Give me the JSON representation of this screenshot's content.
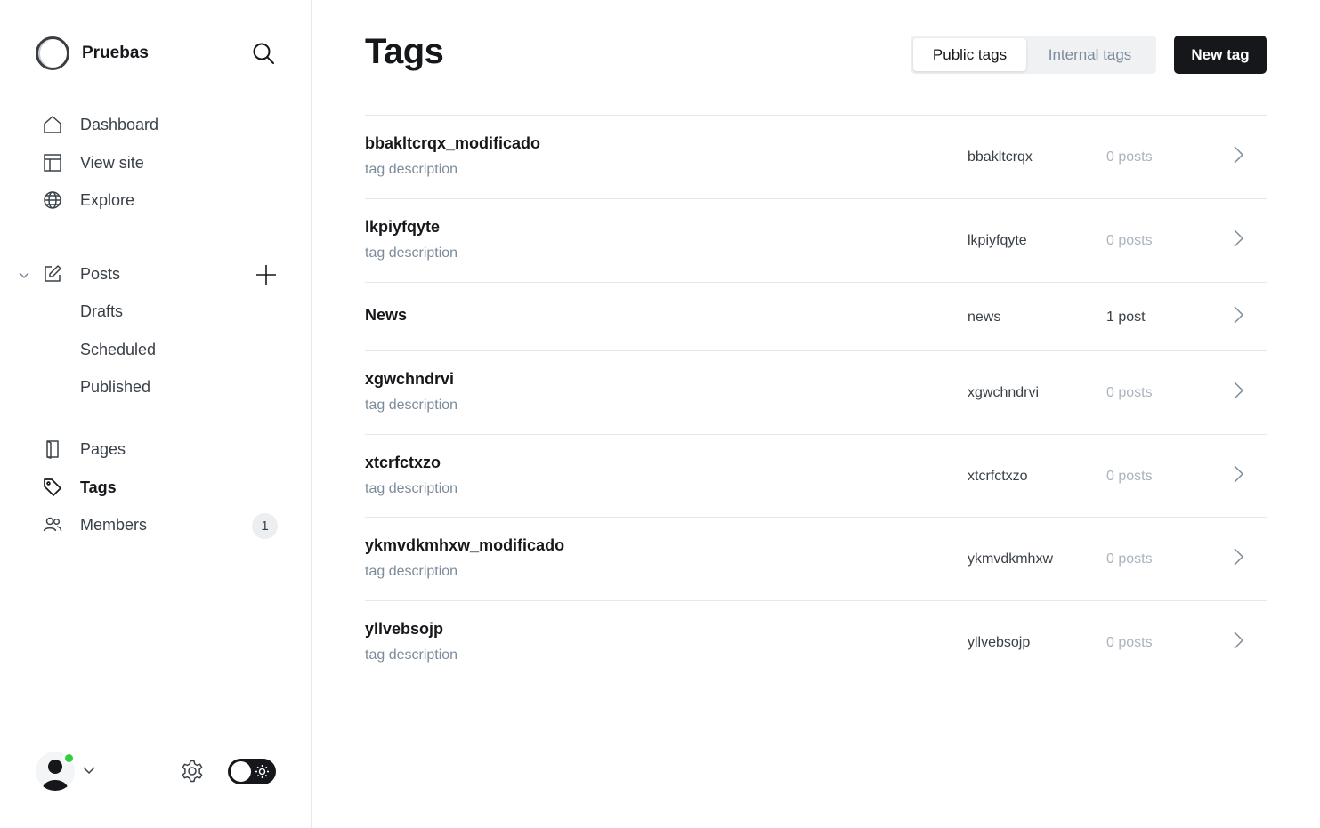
{
  "sidebar": {
    "brand_name": "Pruebas",
    "nav": [
      {
        "label": "Dashboard",
        "icon": "home-icon"
      },
      {
        "label": "View site",
        "icon": "layout-icon"
      },
      {
        "label": "Explore",
        "icon": "globe-icon"
      }
    ],
    "posts": {
      "label": "Posts",
      "icon": "edit-icon",
      "sub_items": [
        "Drafts",
        "Scheduled",
        "Published"
      ]
    },
    "secondary": [
      {
        "label": "Pages",
        "icon": "page-icon"
      },
      {
        "label": "Tags",
        "icon": "tag-icon",
        "active": true
      },
      {
        "label": "Members",
        "icon": "members-icon",
        "badge": "1"
      }
    ]
  },
  "header": {
    "title": "Tags",
    "segments": [
      "Public tags",
      "Internal tags"
    ],
    "active_segment": "Public tags",
    "new_tag_label": "New tag"
  },
  "tags": [
    {
      "name": "bbakltcrqx_modificado",
      "description": "tag description",
      "slug": "bbakltcrqx",
      "count": "0 posts"
    },
    {
      "name": "lkpiyfqyte",
      "description": "tag description",
      "slug": "lkpiyfqyte",
      "count": "0 posts"
    },
    {
      "name": "News",
      "description": "",
      "slug": "news",
      "count": "1 post"
    },
    {
      "name": "xgwchndrvi",
      "description": "tag description",
      "slug": "xgwchndrvi",
      "count": "0 posts"
    },
    {
      "name": "xtcrfctxzo",
      "description": "tag description",
      "slug": "xtcrfctxzo",
      "count": "0 posts"
    },
    {
      "name": "ykmvdkmhxw_modificado",
      "description": "tag description",
      "slug": "ykmvdkmhxw",
      "count": "0 posts"
    },
    {
      "name": "yllvebsojp",
      "description": "tag description",
      "slug": "yllvebsojp",
      "count": "0 posts"
    }
  ],
  "colors": {
    "accent_dark": "#15171a",
    "muted_text": "#7c8b9a",
    "online": "#30cf43",
    "border": "#e6e8eb"
  }
}
